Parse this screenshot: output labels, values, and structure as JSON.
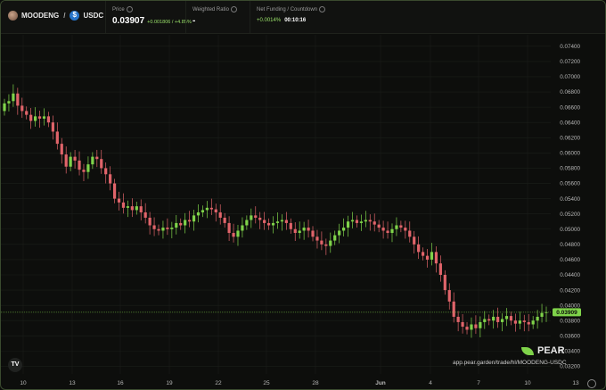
{
  "pair": {
    "base": "MOODENG",
    "separator": "/",
    "quote": "USDC"
  },
  "price": {
    "label": "Price",
    "value": "0.03907",
    "change": "+0.001806",
    "change_sep": "/",
    "change_pct": "+4.85%"
  },
  "weighted_ratio": {
    "label": "Weighted Ratio",
    "value": "-"
  },
  "funding": {
    "label": "Net Funding / Countdown",
    "rate": "+0.0014%",
    "countdown": "00:10:16"
  },
  "brand": {
    "name": "PEAR",
    "url": "app.pear.garden/trade/hl/MOODENG-USDC",
    "tv_logo": "TV"
  },
  "colors": {
    "up": "#7fd34a",
    "down": "#e0646a",
    "accent": "#9be36a"
  },
  "chart_data": {
    "type": "candlestick",
    "y_ticks": [
      "0.07400",
      "0.07200",
      "0.07000",
      "0.06800",
      "0.06600",
      "0.06400",
      "0.06200",
      "0.06000",
      "0.05800",
      "0.05600",
      "0.05400",
      "0.05200",
      "0.05000",
      "0.04800",
      "0.04600",
      "0.04400",
      "0.04200",
      "0.04000",
      "0.03800",
      "0.03600",
      "0.03400",
      "0.03200"
    ],
    "x_ticks": [
      "10",
      "13",
      "16",
      "19",
      "22",
      "25",
      "28",
      "Jun",
      "4",
      "7",
      "10",
      "13"
    ],
    "ylim": [
      0.031,
      0.0755
    ],
    "current_price": "0.03909",
    "grid": true,
    "closes_approx": [
      0.0665,
      0.0668,
      0.0678,
      0.0662,
      0.0655,
      0.065,
      0.0642,
      0.0648,
      0.0645,
      0.0648,
      0.064,
      0.0628,
      0.0612,
      0.0598,
      0.0582,
      0.0595,
      0.059,
      0.0578,
      0.0575,
      0.0585,
      0.0595,
      0.0592,
      0.058,
      0.0572,
      0.056,
      0.054,
      0.0535,
      0.0528,
      0.053,
      0.0525,
      0.053,
      0.0522,
      0.0515,
      0.0505,
      0.05,
      0.0498,
      0.0502,
      0.05,
      0.0502,
      0.0508,
      0.0505,
      0.0512,
      0.051,
      0.0518,
      0.0522,
      0.0525,
      0.0528,
      0.0526,
      0.0522,
      0.0515,
      0.0508,
      0.0495,
      0.049,
      0.0498,
      0.0505,
      0.0512,
      0.0518,
      0.0515,
      0.0512,
      0.0508,
      0.0505,
      0.0508,
      0.051,
      0.0512,
      0.0508,
      0.05,
      0.0495,
      0.0498,
      0.0502,
      0.0498,
      0.049,
      0.0485,
      0.048,
      0.0478,
      0.0485,
      0.0492,
      0.0498,
      0.0502,
      0.051,
      0.0512,
      0.0508,
      0.051,
      0.0512,
      0.051,
      0.0506,
      0.0502,
      0.0498,
      0.0495,
      0.05,
      0.0505,
      0.0502,
      0.0498,
      0.049,
      0.048,
      0.047,
      0.0465,
      0.046,
      0.047,
      0.0455,
      0.044,
      0.042,
      0.0405,
      0.0385,
      0.0378,
      0.0372,
      0.0368,
      0.0375,
      0.037,
      0.0378,
      0.0382,
      0.038,
      0.0385,
      0.0378,
      0.0382,
      0.0386,
      0.038,
      0.0376,
      0.038,
      0.0378,
      0.0375,
      0.038,
      0.0385,
      0.039,
      0.03909
    ]
  }
}
